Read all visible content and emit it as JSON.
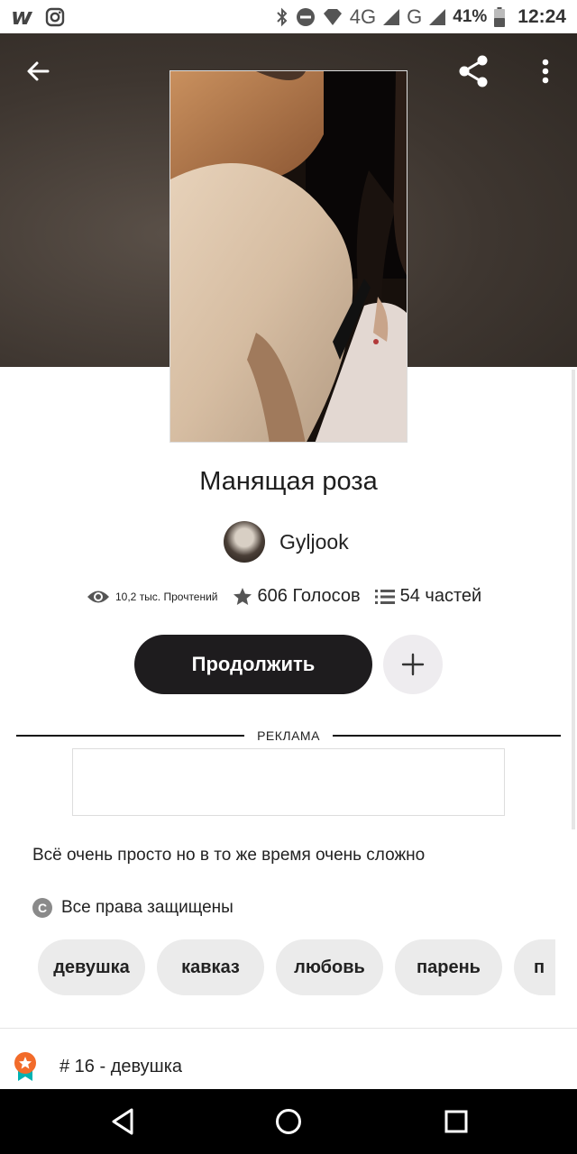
{
  "status_bar": {
    "app_logo": "w",
    "network_4g": "4G",
    "network_g": "G",
    "battery": "41%",
    "time": "12:24"
  },
  "story": {
    "title": "Манящая роза",
    "author": "Gyljook",
    "reads": "10,2 тыс. Прочтений",
    "votes": "606 Голосов",
    "parts": "54 частей",
    "continue_label": "Продолжить",
    "description": "Всё очень просто но в то же время очень сложно",
    "copyright": "Все права защищены"
  },
  "ad": {
    "label": "РЕКЛАМА"
  },
  "tags": [
    "девушка",
    "кавказ",
    "любовь",
    "парень",
    "п"
  ],
  "rank": {
    "text": "# 16 - девушка"
  },
  "colors": {
    "accent_dark": "#1e1c1e",
    "rank_orange": "#f26b2a",
    "rank_teal": "#00b2b2"
  },
  "icons": {
    "back": "arrow-left-icon",
    "share": "share-icon",
    "more": "more-vertical-icon",
    "reads": "eye-icon",
    "votes": "star-icon",
    "parts": "list-icon",
    "add": "plus-icon",
    "copyright": "copyright-icon",
    "rank": "award-icon"
  }
}
